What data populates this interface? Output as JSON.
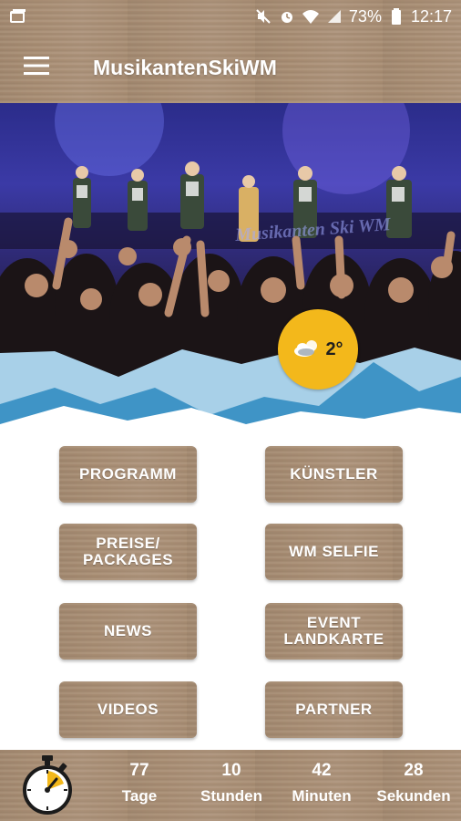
{
  "status_bar": {
    "battery": "73%",
    "time": "12:17",
    "icons": [
      "gallery-icon",
      "mute-icon",
      "alarm-icon",
      "wifi-icon",
      "signal-icon",
      "battery-icon"
    ]
  },
  "app_bar": {
    "title": "MusikantenSkiWM",
    "menu_icon": "hamburger-menu-icon"
  },
  "hero": {
    "banner_text": "Musikanten Ski WM",
    "weather": {
      "icon": "cloud-sun-icon",
      "temperature": "2°"
    }
  },
  "menu": {
    "programm": "PROGRAMM",
    "kuenstler": "KÜNSTLER",
    "preise": "PREISE/ PACKAGES",
    "selfie": "WM SELFIE",
    "news": "NEWS",
    "landkarte": "EVENT LANDKARTE",
    "videos": "VIDEOS",
    "partner": "PARTNER"
  },
  "countdown": {
    "icon": "stopwatch-icon",
    "items": [
      {
        "value": "77",
        "label": "Tage"
      },
      {
        "value": "10",
        "label": "Stunden"
      },
      {
        "value": "42",
        "label": "Minuten"
      },
      {
        "value": "28",
        "label": "Sekunden"
      }
    ]
  },
  "colors": {
    "wood": "#a88d73",
    "weather_badge": "#f3b81b",
    "mountain_light": "#a8d0e8",
    "mountain_dark": "#3f94c6"
  }
}
